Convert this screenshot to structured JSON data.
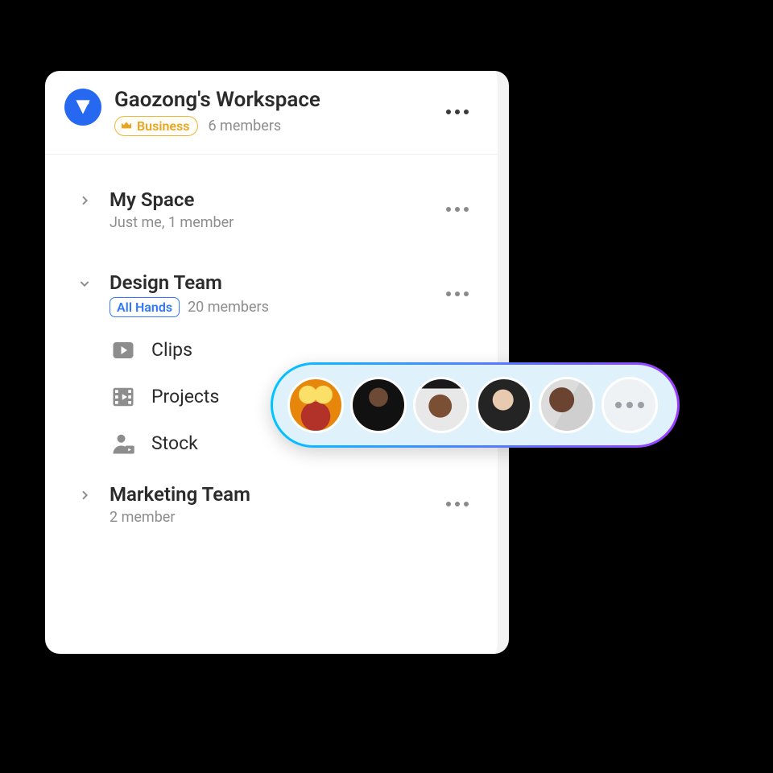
{
  "workspace": {
    "title": "Gaozong's Workspace",
    "plan_label": "Business",
    "members_text": "6 members"
  },
  "spaces": [
    {
      "title": "My Space",
      "subtitle": "Just me, 1 member",
      "expanded": false
    },
    {
      "title": "Design Team",
      "tag": "All Hands",
      "members_text": "20 members",
      "expanded": true,
      "children": [
        {
          "icon": "play",
          "label": "Clips"
        },
        {
          "icon": "film",
          "label": "Projects"
        },
        {
          "icon": "user-stock",
          "label": "Stock"
        }
      ]
    },
    {
      "title": "Marketing Team",
      "subtitle": "2 member",
      "expanded": false
    }
  ],
  "avatar_pill": {
    "avatar_count_shown": 5,
    "has_more": true
  }
}
